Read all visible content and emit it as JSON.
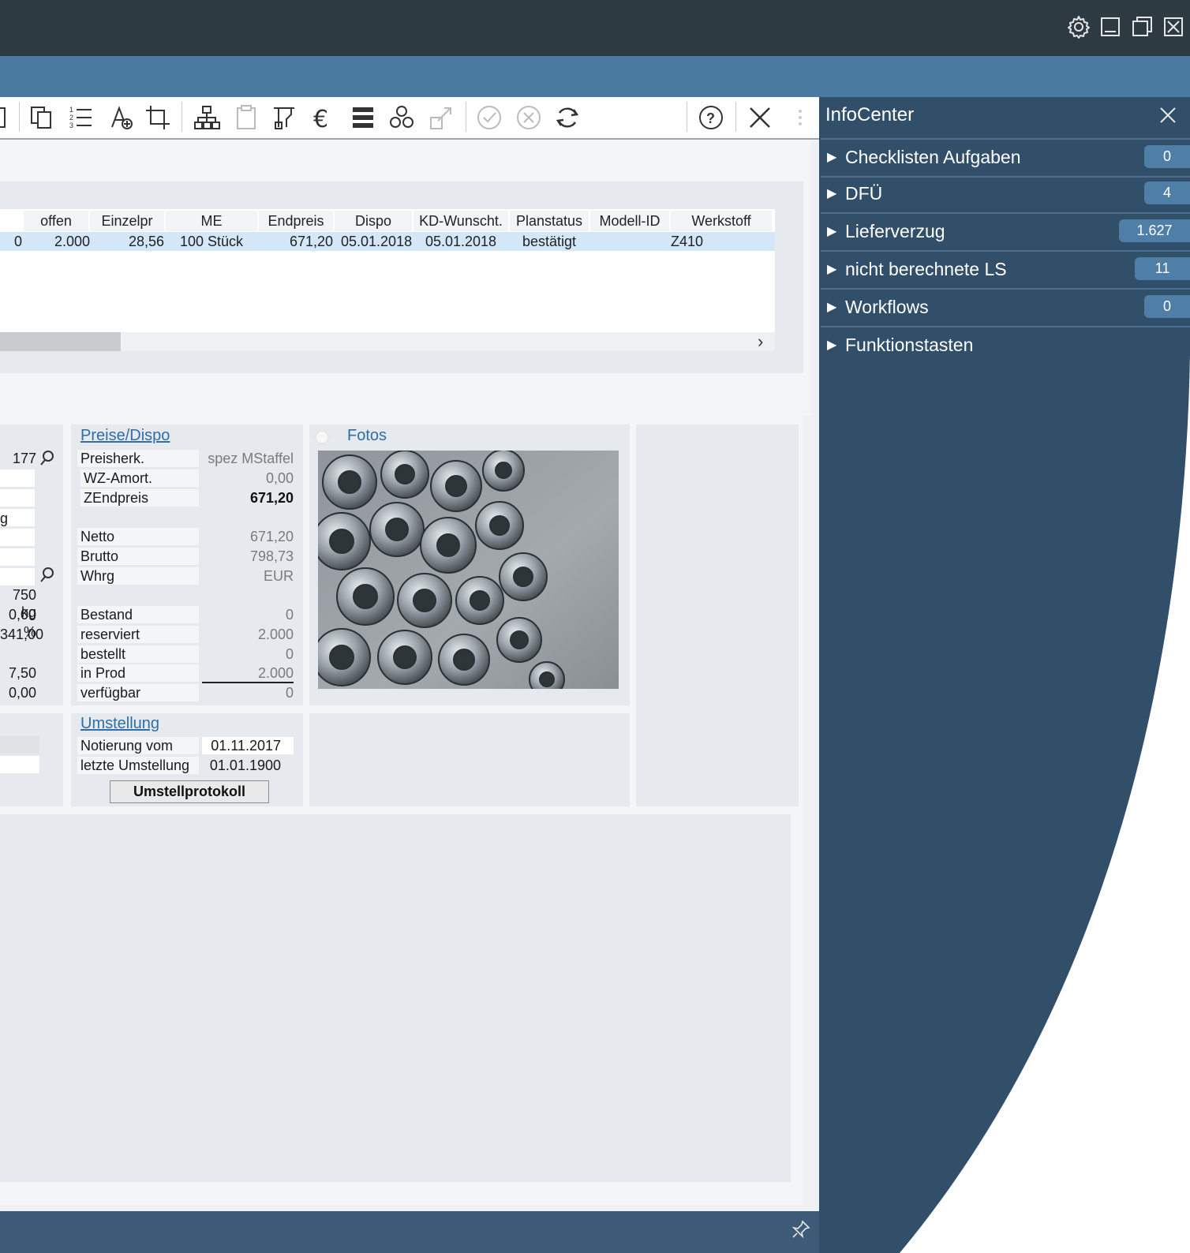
{
  "toolbar": {
    "icons": [
      "document-icon",
      "copy-icon",
      "numbered-list-icon",
      "add-text-icon",
      "crop-icon",
      "hierarchy-icon",
      "clipboard-icon",
      "machine-icon",
      "euro-icon",
      "stack-icon",
      "cubes-icon",
      "export-icon",
      "check-circle-icon",
      "cancel-circle-icon",
      "refresh-icon",
      "help-icon",
      "close-icon",
      "more-icon"
    ]
  },
  "grid": {
    "headers": [
      "offen",
      "Einzelpr",
      "ME",
      "Endpreis",
      "Dispo",
      "KD-Wunscht.",
      "Planstatus",
      "Modell-ID",
      "Werkstoff"
    ],
    "row": {
      "c0": "0",
      "offen": "2.000",
      "einzelpr": "28,56",
      "me": "100 Stück",
      "endpreis": "671,20",
      "dispo": "05.01.2018",
      "kd_wunscht": "05.01.2018",
      "planstatus": "bestätigt",
      "modell_id": "",
      "werkstoff": "Z410"
    },
    "scroll_arrow": "›"
  },
  "left_column": {
    "values": [
      "177",
      "g",
      "750 kg",
      "0,00 %",
      "341,00",
      "7,50",
      "0,00"
    ]
  },
  "preise": {
    "title": "Preise/Dispo",
    "rows": [
      {
        "label": "Preisherk.",
        "value": "spez MStaffel"
      },
      {
        "label": "WZ-Amort.",
        "value": "0,00"
      },
      {
        "label": "ZEndpreis",
        "value": "671,20"
      },
      {
        "label": "Netto",
        "value": "671,20"
      },
      {
        "label": "Brutto",
        "value": "798,73"
      },
      {
        "label": "Whrg",
        "value": "EUR"
      },
      {
        "label": "Bestand",
        "value": "0"
      },
      {
        "label": "reserviert",
        "value": "2.000"
      },
      {
        "label": "bestellt",
        "value": "0"
      },
      {
        "label": "in Prod",
        "value": "2.000"
      },
      {
        "label": "verfügbar",
        "value": "0"
      }
    ]
  },
  "fotos": {
    "title": "Fotos"
  },
  "umstellung": {
    "title": "Umstellung",
    "rows": [
      {
        "label": "Notierung vom",
        "value": "01.11.2017"
      },
      {
        "label": "letzte Umstellung",
        "value": "01.01.1900"
      }
    ],
    "button": "Umstellprotokoll"
  },
  "infocenter": {
    "title": "InfoCenter",
    "items": [
      {
        "label": "Checklisten Aufgaben",
        "count": "0"
      },
      {
        "label": "DFÜ",
        "count": "4"
      },
      {
        "label": "Lieferverzug",
        "count": "1.627"
      },
      {
        "label": "nicht berechnete LS",
        "count": "11"
      },
      {
        "label": "Workflows",
        "count": "0"
      },
      {
        "label": "Funktionstasten",
        "count": ""
      }
    ]
  },
  "colors": {
    "titlebar": "#2e3a42",
    "accent_blue": "#4a7aa0",
    "infocenter_bg": "#324f6a",
    "link": "#2f6ea6",
    "selected_row": "#d3e7f8"
  }
}
